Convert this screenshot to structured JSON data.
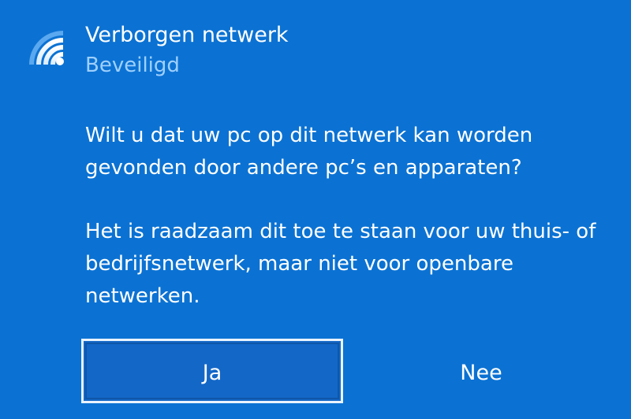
{
  "network": {
    "name": "Verborgen netwerk",
    "status": "Beveiligd",
    "icon": "wifi-signal-icon"
  },
  "prompt": {
    "question": "Wilt u dat uw pc op dit netwerk kan worden gevonden door andere pc’s en apparaten?",
    "advice": "Het is raadzaam dit toe te staan voor uw thuis- of bedrijfsnetwerk, maar niet voor openbare netwerken."
  },
  "buttons": {
    "yes_label": "Ja",
    "no_label": "Nee"
  },
  "colors": {
    "background": "#0b72d3",
    "status_text": "#9fd0ff",
    "button_fill": "#1367c7"
  }
}
